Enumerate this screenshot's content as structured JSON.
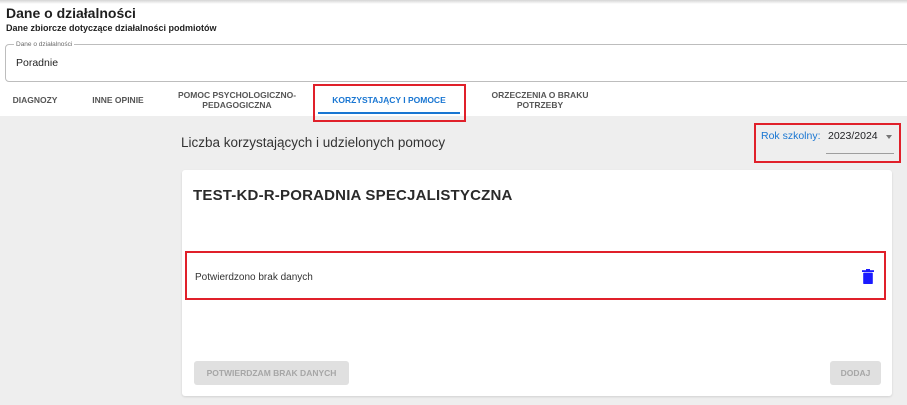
{
  "header": {
    "title": "Dane o działalności",
    "subtitle": "Dane zbiorcze dotyczące działalności podmiotów"
  },
  "activity_field": {
    "legend": "Dane o działalności",
    "value": "Poradnie"
  },
  "tabs": [
    {
      "label": "DIAGNOZY",
      "active": false
    },
    {
      "label": "INNE OPINIE",
      "active": false
    },
    {
      "label": "POMOC PSYCHOLOGICZNO-PEDAGOGICZNA",
      "active": false
    },
    {
      "label": "KORZYSTAJĄCY I POMOCE",
      "active": true
    },
    {
      "label": "ORZECZENIA O BRAKU POTRZEBY",
      "active": false
    }
  ],
  "section": {
    "title": "Liczba korzystających i udzielonych pomocy",
    "year_label": "Rok szkolny:",
    "year_value": "2023/2024"
  },
  "card": {
    "title": "TEST-KD-R-PORADNIA SPECJALISTYCZNA",
    "row_text": "Potwierdzono brak danych",
    "confirm_button": "POTWIERDZAM BRAK DANYCH",
    "add_button": "DODAJ"
  },
  "colors": {
    "accent": "#1976d2",
    "highlight": "#e0202a",
    "delete_icon": "#1a1aff"
  }
}
